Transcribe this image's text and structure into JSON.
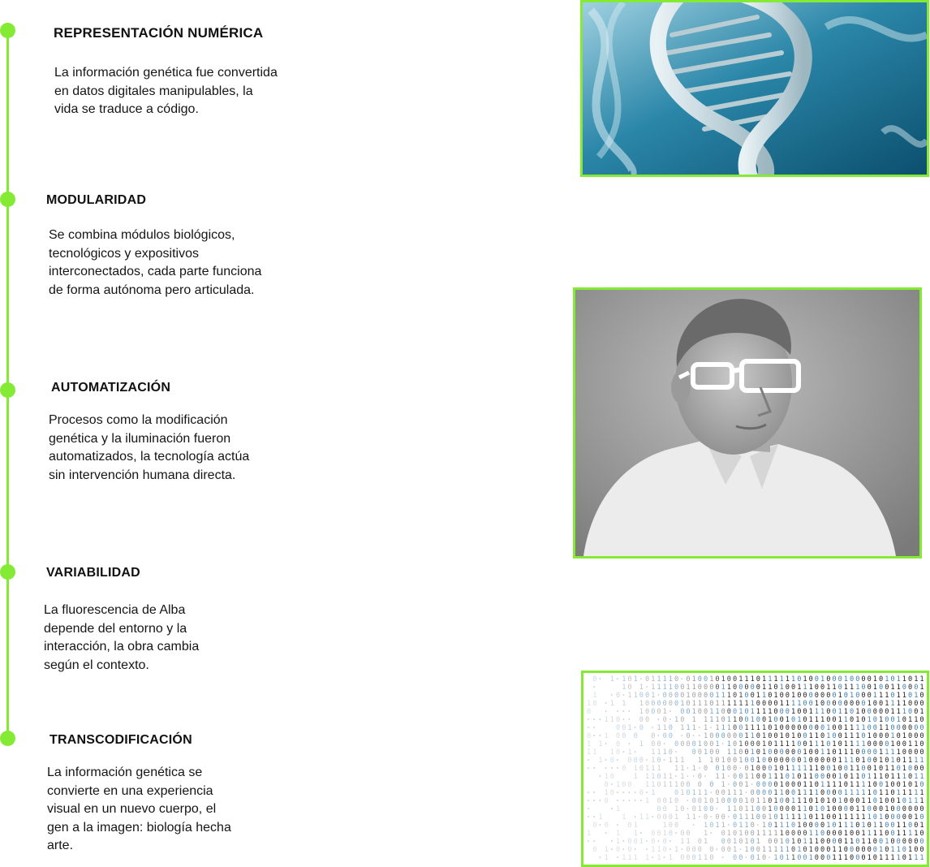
{
  "colors": {
    "accent": "#84ea34",
    "text": "#111111",
    "dna_bg": "#1d6f8e"
  },
  "sections": [
    {
      "title": "REPRESENTACIÓN NUMÉRICA",
      "lines": [
        "La información genética fue convertida",
        "en datos digitales manipulables, la",
        "vida se traduce a código."
      ]
    },
    {
      "title": "MODULARIDAD",
      "lines": [
        "Se combina módulos biológicos,",
        "tecnológicos y expositivos",
        "interconectados, cada parte funciona",
        "de forma autónoma pero articulada."
      ]
    },
    {
      "title": "AUTOMATIZACIÓN",
      "lines": [
        "Procesos como la modificación",
        "genética y la iluminación fueron",
        "automatizados, la tecnología actúa",
        "sin intervención humana directa."
      ]
    },
    {
      "title": "VARIABILIDAD",
      "lines": [
        "La fluorescencia de Alba",
        "depende del entorno y la",
        "interacción, la obra cambia",
        "según el contexto."
      ]
    },
    {
      "title": "TRANSCODIFICACIÓN",
      "lines": [
        "La información genética se",
        "convierte en una experiencia",
        "visual en un nuevo cuerpo, el",
        "gen a la imagen: biología hecha",
        "arte."
      ]
    }
  ],
  "images": [
    {
      "subject": "dna-double-helix"
    },
    {
      "subject": "man-with-white-glasses-grayscale-portrait"
    },
    {
      "subject": "binary-code-matrix"
    }
  ]
}
